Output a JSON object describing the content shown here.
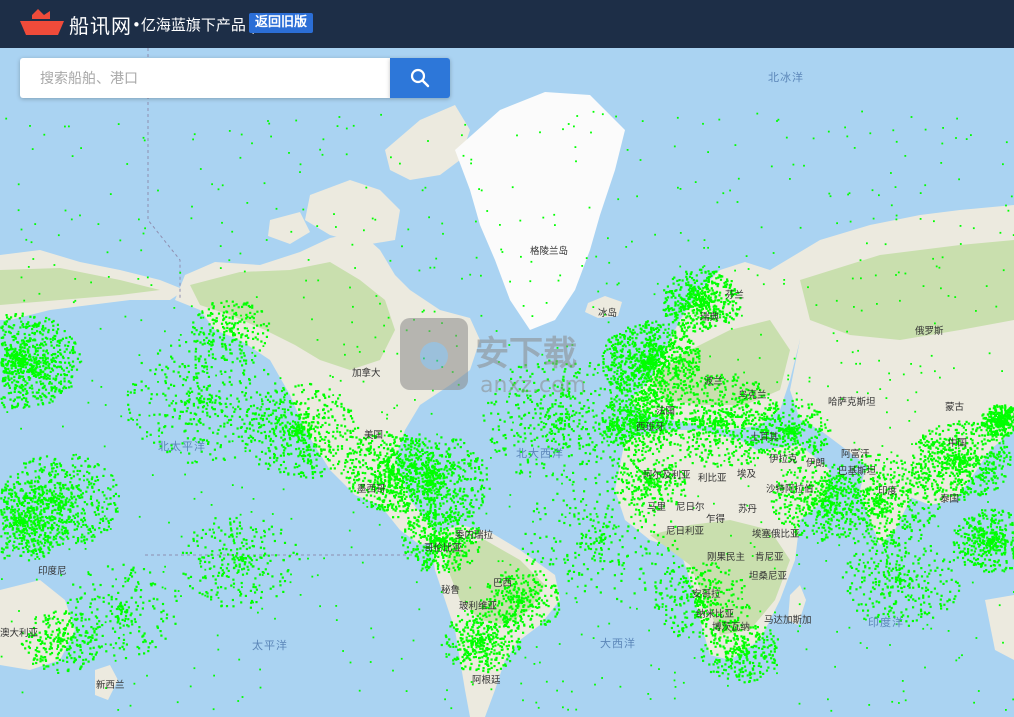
{
  "header": {
    "brand": "船讯网",
    "slogan": "•亿海蓝旗下产品 |",
    "back_button": "返回旧版"
  },
  "search": {
    "placeholder": "搜索船舶、港口"
  },
  "colors": {
    "header_bg": "#1d2e47",
    "accent": "#2d77d9",
    "ocean": "#aad3f2",
    "vessel": "#00ff00"
  },
  "icons": [
    "ship-logo-icon",
    "search-icon"
  ],
  "map": {
    "oceans": {
      "arctic": "北冰洋",
      "north_pacific": "北太平洋",
      "north_atlantic": "北大西洋",
      "south_pacific": "太平洋",
      "south_atlantic": "大西洋",
      "indian": "印度洋"
    },
    "places": {
      "greenland": "格陵兰岛",
      "iceland": "冰岛",
      "finland": "芬兰",
      "sweden": "瑞典",
      "russia": "俄罗斯",
      "canada": "加拿大",
      "usa": "美国",
      "mexico": "墨西哥",
      "venezuela": "委内瑞拉",
      "colombia": "哥伦比亚",
      "peru": "秘鲁",
      "brazil": "巴西",
      "bolivia": "玻利维亚",
      "argentina": "阿根廷",
      "poland": "波兰",
      "ukraine": "乌克兰",
      "france": "法国",
      "spain": "西班牙",
      "kazakhstan": "哈萨克斯坦",
      "mongolia": "蒙古",
      "china": "中国",
      "turkey": "土耳其",
      "iraq": "伊拉克",
      "iran": "伊朗",
      "afghanistan": "阿富汗",
      "pakistan": "巴基斯坦",
      "india": "印度",
      "thailand": "泰国",
      "saudi": "沙特阿拉伯",
      "algeria": "阿尔及利亚",
      "libya": "利比亚",
      "egypt": "埃及",
      "mali": "马里",
      "niger": "尼日尔",
      "chad": "乍得",
      "sudan": "苏丹",
      "nigeria": "尼日利亚",
      "ethiopia": "埃塞俄比亚",
      "drc": "刚果民主",
      "kenya": "肯尼亚",
      "tanzania": "坦桑尼亚",
      "angola": "安哥拉",
      "namibia": "纳米比亚",
      "botswana": "博茨瓦纳",
      "madagascar": "马达加斯加",
      "indonesia": "印度尼",
      "australia": "澳大利亚",
      "new_zealand": "新西兰"
    }
  },
  "watermark": {
    "text": "安下载",
    "url": "anxz.com"
  }
}
